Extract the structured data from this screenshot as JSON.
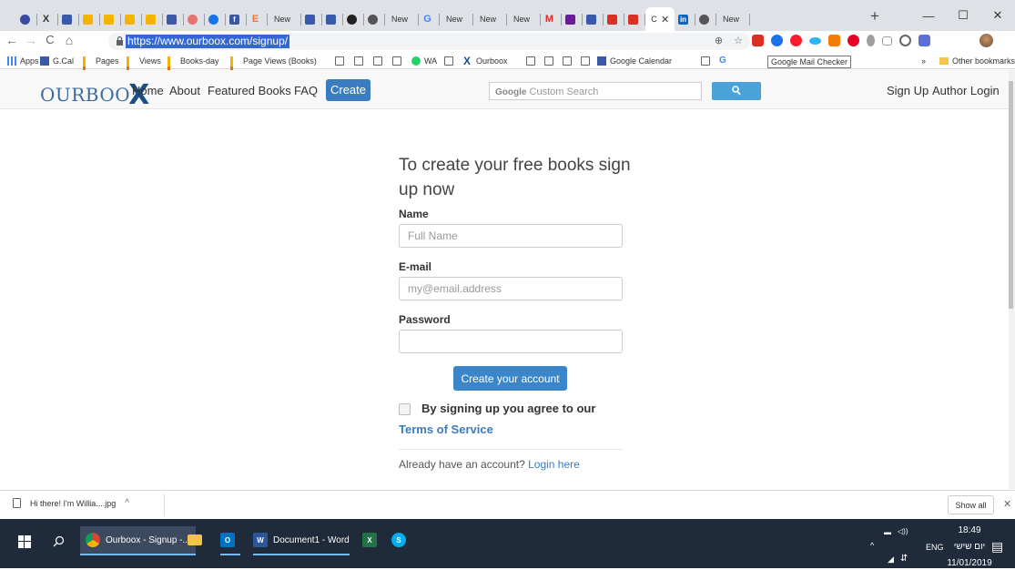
{
  "browser": {
    "active_tab_close": "✕",
    "tab_new_label": "New",
    "new_tab_symbol": "+",
    "window": {
      "minimize": "—",
      "maximize": "☐",
      "close": "✕"
    },
    "url": "https://www.ourboox.com/signup/",
    "nav": {
      "back": "←",
      "forward": "→",
      "reload": "C",
      "home": "⌂"
    },
    "omnibox_icons": {
      "zoom": "⊕",
      "star": "☆"
    },
    "menu": "⋮"
  },
  "bookmarks": {
    "apps": "Apps",
    "gcal": "G.Cal",
    "pages": "Pages",
    "views": "Views",
    "books_day": "Books-day",
    "page_views_books": "Page Views (Books)",
    "wa": "WA",
    "ourboox": "Ourboox",
    "google_calendar": "Google Calendar",
    "g": "G",
    "overflow": "»",
    "other": "Other bookmarks",
    "tooltip": "Google Mail Checker"
  },
  "site": {
    "logo_text": "OURBOO",
    "logo_x": "X",
    "nav": {
      "home": "Home",
      "about": "About",
      "featured": "Featured Books",
      "faq": "FAQ",
      "create": "Create"
    },
    "search_placeholder_google": "Google",
    "search_placeholder_text": "Custom Search",
    "signup": "Sign Up",
    "author_login": "Author Login"
  },
  "form": {
    "heading": "To create your free books sign up now",
    "name_label": "Name",
    "name_placeholder": "Full Name",
    "email_label": "E-mail",
    "email_placeholder": "my@email.address",
    "password_label": "Password",
    "submit": "Create your account",
    "agree": "By signing up you agree to our",
    "tos": "Terms of Service",
    "already": "Already have an account?",
    "login_here": "Login here"
  },
  "downloads": {
    "file": "Hi there! I'm Willia....jpg",
    "chevron": "^",
    "show_all": "Show all",
    "close": "✕"
  },
  "taskbar": {
    "chrome_app": "Ourboox - Signup -...",
    "word_app": "Document1 - Word",
    "language": "ENG",
    "time": "18:49",
    "day": "יום שישי",
    "date": "11/01/2019",
    "tray_up": "^"
  },
  "colors": {
    "brand_blue": "#3a7cc0",
    "search_button": "#4aa2d8",
    "taskbar": "#1f2a3a"
  }
}
